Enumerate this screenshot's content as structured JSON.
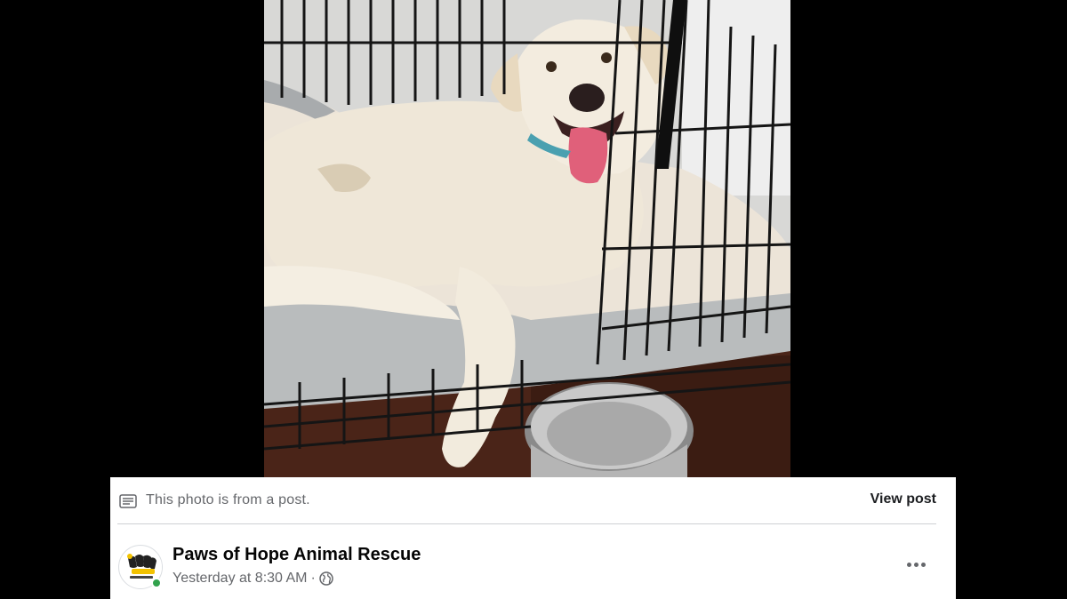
{
  "photo": {
    "alt": "",
    "colors": {
      "wall": "#d8d8d6",
      "floor": "#4a2418",
      "bed": "#ece4d8",
      "bed_edge": "#b9bcbd",
      "dog": "#efe7d8",
      "crate": "#151515",
      "bowl": "#c9c9c9",
      "tongue": "#e0607a"
    }
  },
  "notice": {
    "icon": "post-document-icon",
    "text": "This photo is from a post.",
    "view_post_label": "View post"
  },
  "author": {
    "name": "Paws of Hope Animal Rescue",
    "timestamp": "Yesterday at 8:30 AM",
    "separator": "·",
    "audience_icon": "globe-icon",
    "avatar_icon": "paws-of-hope-logo",
    "online_status": true,
    "more_icon": "more-options-icon"
  },
  "colors": {
    "background": "#000000",
    "card": "#ffffff",
    "secondary_text": "#65676b",
    "primary_text": "#050505",
    "online": "#31a24c"
  }
}
